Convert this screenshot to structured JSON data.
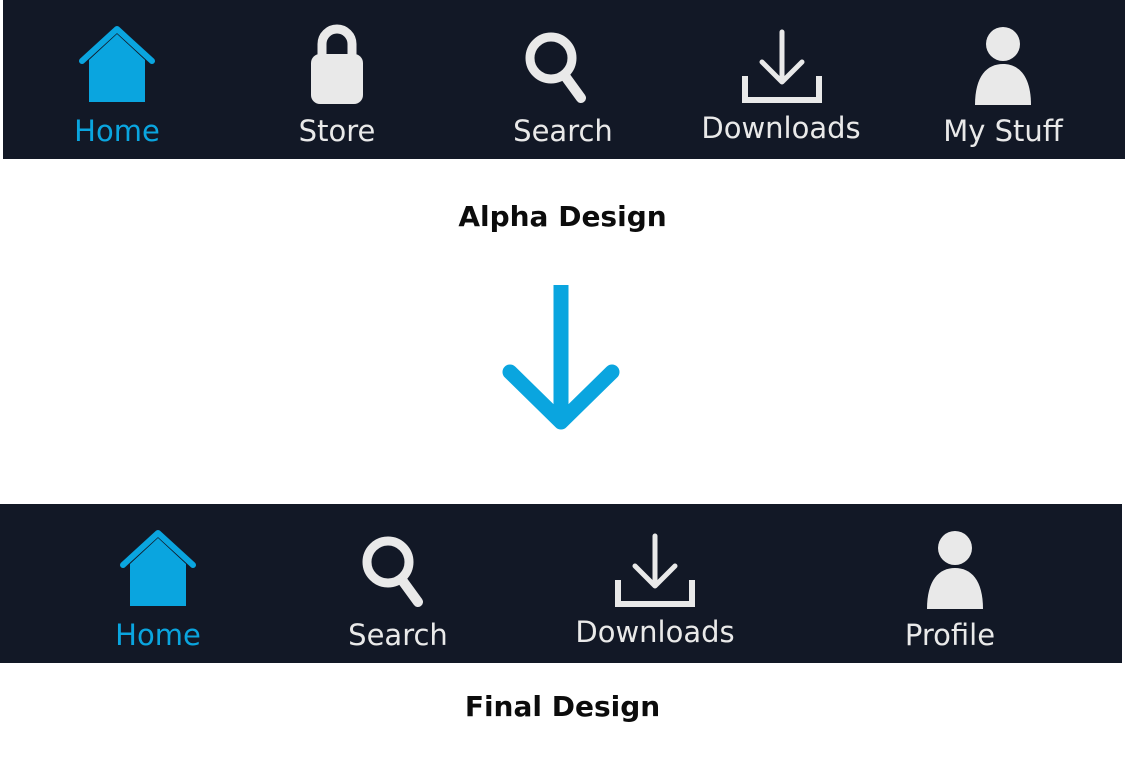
{
  "colors": {
    "navbar_background": "#121826",
    "active_accent": "#0aa5df",
    "inactive_icon": "#e9e9e9",
    "page_background": "#ffffff"
  },
  "alpha": {
    "caption": "Alpha Design",
    "tabs": [
      {
        "label": "Home",
        "icon": "home-icon",
        "active": true
      },
      {
        "label": "Store",
        "icon": "lock-icon",
        "active": false
      },
      {
        "label": "Search",
        "icon": "search-icon",
        "active": false
      },
      {
        "label": "Downloads",
        "icon": "download-icon",
        "active": false
      },
      {
        "label": "My Stuff",
        "icon": "person-icon",
        "active": false
      }
    ]
  },
  "transition": {
    "icon": "arrow-down-icon"
  },
  "final": {
    "caption": "Final Design",
    "tabs": [
      {
        "label": "Home",
        "icon": "home-icon",
        "active": true
      },
      {
        "label": "Search",
        "icon": "search-icon",
        "active": false
      },
      {
        "label": "Downloads",
        "icon": "download-icon",
        "active": false
      },
      {
        "label": "Profile",
        "icon": "person-icon",
        "active": false
      }
    ]
  }
}
